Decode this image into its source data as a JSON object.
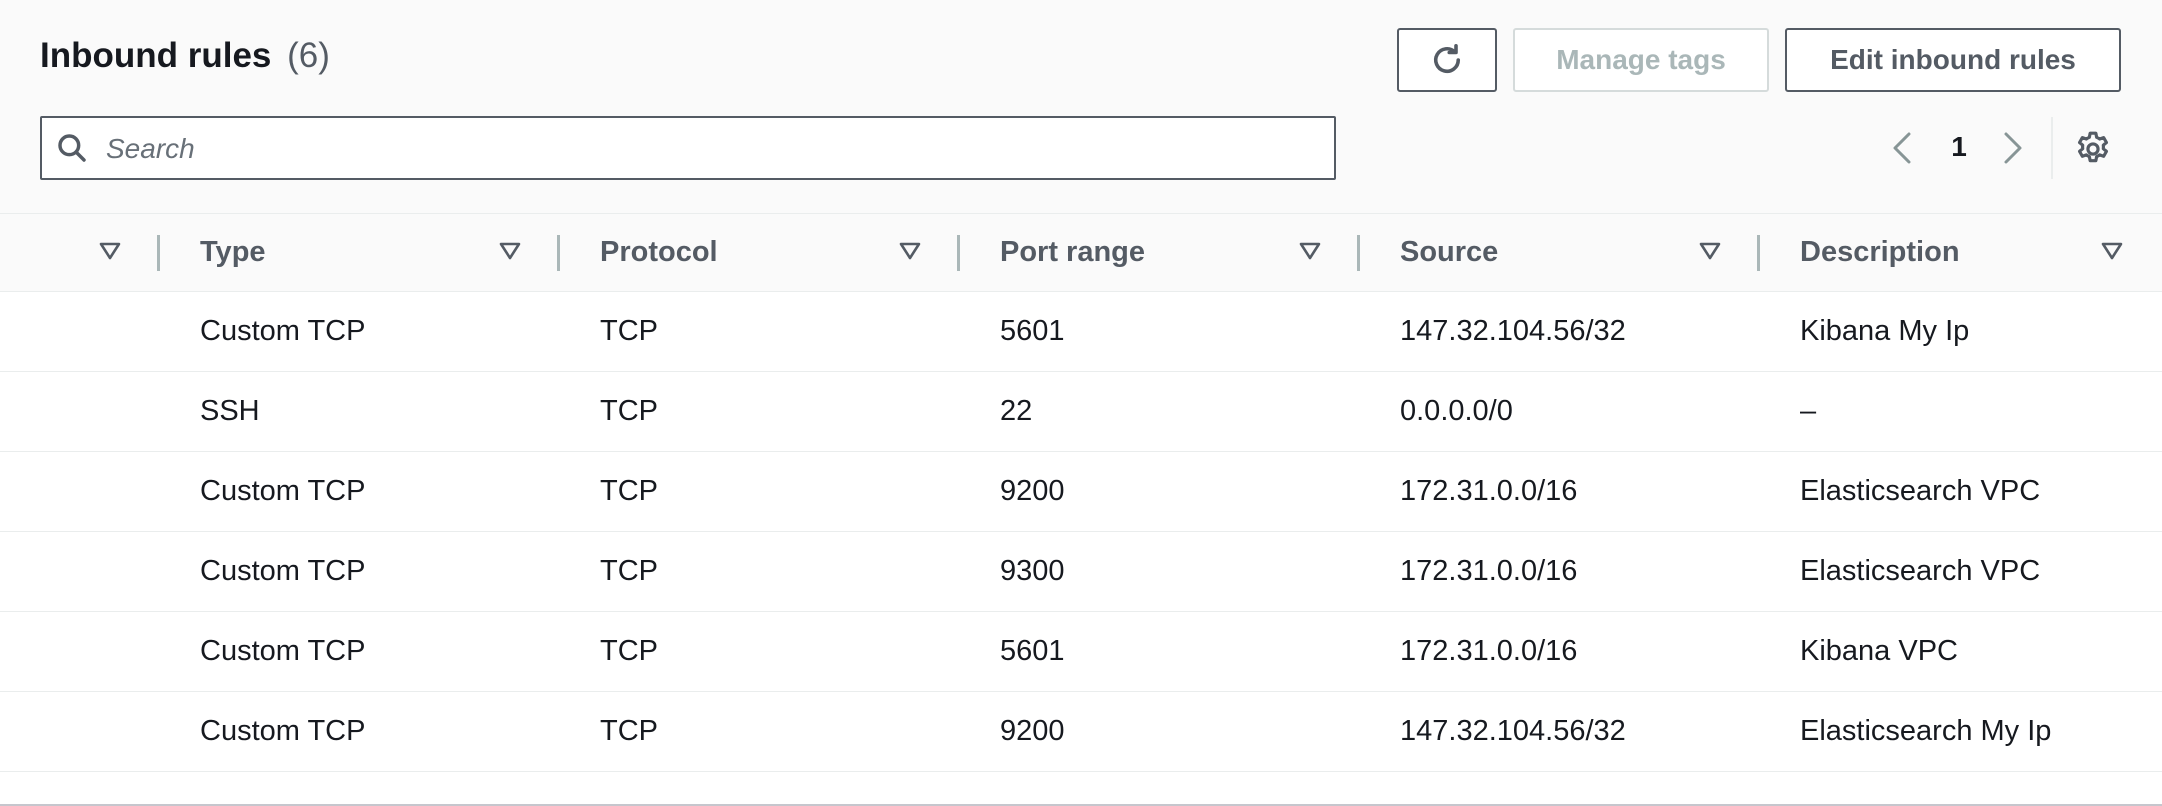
{
  "header": {
    "title": "Inbound rules",
    "count": "(6)",
    "buttons": {
      "refresh_icon": "refresh-icon",
      "manage_tags": "Manage tags",
      "edit_inbound_rules": "Edit inbound rules"
    }
  },
  "search": {
    "placeholder": "Search",
    "value": "",
    "icon": "search-icon"
  },
  "pagination": {
    "current_page": "1",
    "prev_icon": "chevron-left-icon",
    "next_icon": "chevron-right-icon",
    "settings_icon": "gear-icon"
  },
  "table": {
    "columns": [
      "",
      "Type",
      "Protocol",
      "Port range",
      "Source",
      "Description"
    ],
    "rows": [
      {
        "type": "Custom TCP",
        "protocol": "TCP",
        "port_range": "5601",
        "source": "147.32.104.56/32",
        "description": "Kibana My Ip"
      },
      {
        "type": "SSH",
        "protocol": "TCP",
        "port_range": "22",
        "source": "0.0.0.0/0",
        "description": "–"
      },
      {
        "type": "Custom TCP",
        "protocol": "TCP",
        "port_range": "9200",
        "source": "172.31.0.0/16",
        "description": "Elasticsearch VPC"
      },
      {
        "type": "Custom TCP",
        "protocol": "TCP",
        "port_range": "9300",
        "source": "172.31.0.0/16",
        "description": "Elasticsearch VPC"
      },
      {
        "type": "Custom TCP",
        "protocol": "TCP",
        "port_range": "5601",
        "source": "172.31.0.0/16",
        "description": "Kibana VPC"
      },
      {
        "type": "Custom TCP",
        "protocol": "TCP",
        "port_range": "9200",
        "source": "147.32.104.56/32",
        "description": "Elasticsearch My Ip"
      }
    ]
  },
  "colors": {
    "text_primary": "#16191f",
    "text_secondary": "#545b64",
    "border_dark": "#545b64",
    "disabled_text": "#aab7b8",
    "header_bg": "#fafafa",
    "row_divider": "#eaeded"
  }
}
